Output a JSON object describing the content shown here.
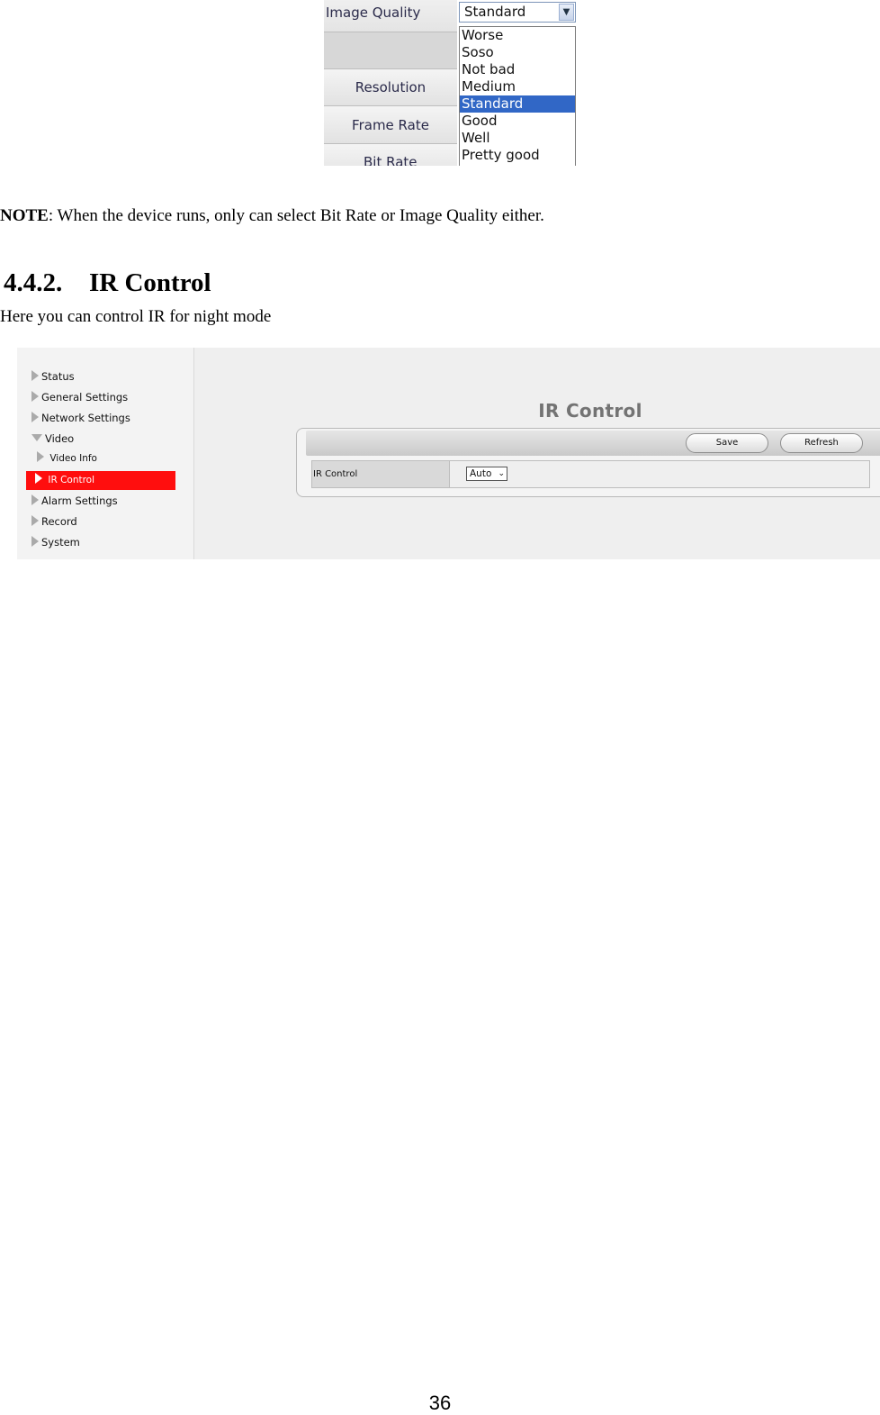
{
  "image_quality_screenshot": {
    "labels": [
      "Image Quality",
      "",
      "Resolution",
      "Frame Rate",
      "Bit Rate"
    ],
    "select_value": "Standard",
    "select_arrow_icon": "dropdown-arrow-icon",
    "options": [
      "Worse",
      "Soso",
      "Not bad",
      "Medium",
      "Standard",
      "Good",
      "Well",
      "Pretty good"
    ],
    "selected_option": "Standard",
    "highlight_color": "#3167c6"
  },
  "note": {
    "label": "NOTE",
    "text": ": When the device runs, only can select Bit Rate or Image Quality either."
  },
  "section": {
    "number": "4.4.2.",
    "title": "IR Control",
    "intro": "Here you can control IR for night mode"
  },
  "ir_screenshot": {
    "sidebar": [
      {
        "label": "Status",
        "expanded": false
      },
      {
        "label": "General Settings",
        "expanded": false
      },
      {
        "label": "Network Settings",
        "expanded": false
      },
      {
        "label": "Video",
        "expanded": true
      },
      {
        "label": "Video Info",
        "sub": true
      },
      {
        "label": "IR Control",
        "sub": true,
        "active": true
      },
      {
        "label": "Alarm Settings",
        "expanded": false
      },
      {
        "label": "Record",
        "expanded": false
      },
      {
        "label": "System",
        "expanded": false
      }
    ],
    "active_color": "#ff0e0e",
    "title": "IR Control",
    "buttons": {
      "save": "Save",
      "refresh": "Refresh"
    },
    "field": {
      "label": "IR Control",
      "value": "Auto"
    }
  },
  "page_number": "36"
}
